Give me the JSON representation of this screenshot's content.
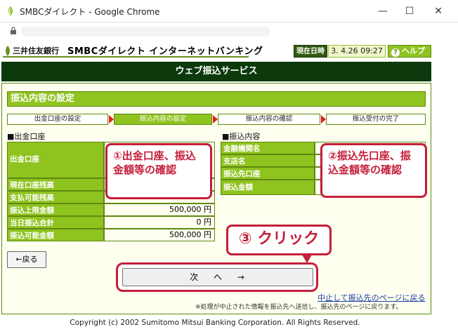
{
  "window": {
    "title": "SMBCダイレクト - Google Chrome"
  },
  "header": {
    "bank_name": "三井住友銀行",
    "service_name": "SMBCダイレクト インターネットバンキング",
    "datetime_label": "現在日時",
    "datetime_value": "3. 4.26 09:27",
    "help_label": "ヘルプ"
  },
  "service_bar": "ウェブ振込サービス",
  "section_title": "振込内容の設定",
  "steps": [
    {
      "label": "出金口座の設定"
    },
    {
      "label": "振込内容の設定"
    },
    {
      "label": "振込内容の確認"
    },
    {
      "label": "振込受付の完了"
    }
  ],
  "left_panel": {
    "title": "■出金口座",
    "rows": [
      {
        "label": "出金口座",
        "value": ""
      },
      {
        "label": "現在口座残高",
        "value": ""
      },
      {
        "label": "支払可能残高",
        "value": ""
      },
      {
        "label": "振込上限金額",
        "value": "500,000 円"
      },
      {
        "label": "当日振込合計",
        "value": "0 円"
      },
      {
        "label": "振込可能金額",
        "value": "500,000 円"
      }
    ]
  },
  "right_panel": {
    "title": "■振込内容",
    "rows": [
      {
        "label": "金融機関名",
        "value": ""
      },
      {
        "label": "支店名",
        "value": ""
      },
      {
        "label": "振込先口座",
        "value": ""
      },
      {
        "label": "振込金額",
        "value": ""
      }
    ]
  },
  "callouts": {
    "one": "①出金口座、振込金額等の確認",
    "two": "②振込先口座、振込金額等の確認",
    "three": "③ クリック"
  },
  "buttons": {
    "back": "←戻る",
    "next": "次　 へ　 →"
  },
  "cancel_link": "中止して振込先のページに戻る",
  "note": "※処理が中止された情報を振込先へ送信し、振込先のページに戻ります。",
  "footer": "Copyright (c) 2002 Sumitomo Mitsui Banking Corporation. All Rights Reserved.",
  "colors": {
    "accent_green": "#8fc31f",
    "dark_green": "#0c3a0c",
    "callout_red": "#c41e3a"
  }
}
